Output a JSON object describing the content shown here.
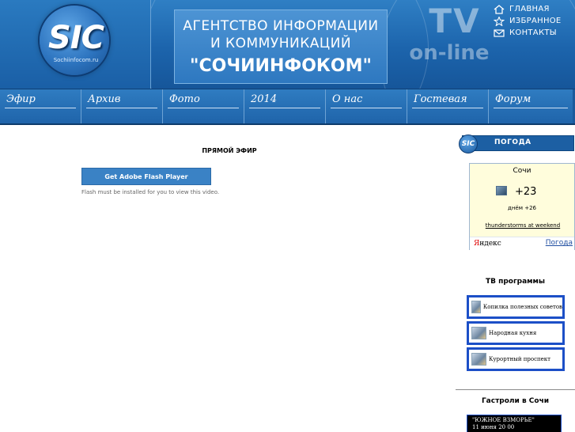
{
  "header": {
    "logo_text": "SIC",
    "logo_url": "Sochiinfocom.ru",
    "title_line1": "АГЕНТСТВО ИНФОРМАЦИИ",
    "title_line2": "И КОММУНИКАЦИЙ",
    "title_line3": "\"СОЧИИНФОКОМ\"",
    "tv_text": "TV",
    "online_text": "on-line",
    "links": [
      {
        "label": "ГЛАВНАЯ",
        "icon": "home-icon"
      },
      {
        "label": "ИЗБРАННОЕ",
        "icon": "star-icon"
      },
      {
        "label": "КОНТАКТЫ",
        "icon": "mail-icon"
      }
    ]
  },
  "nav": {
    "items": [
      {
        "label": "Эфир"
      },
      {
        "label": "Архив"
      },
      {
        "label": "Фото"
      },
      {
        "label": "2014"
      },
      {
        "label": "О нас"
      },
      {
        "label": "Гостевая"
      },
      {
        "label": "Форум"
      }
    ]
  },
  "main": {
    "live_title": "ПРЯМОЙ ЭФИР",
    "flash_button": "Get Adobe Flash Player",
    "flash_note": "Flash must be installed for you to view this video."
  },
  "sidebar": {
    "weather": {
      "logo_text": "SIC",
      "header": "ПОГОДА",
      "city": "Сочи",
      "temp": "+23",
      "day": "днём +26",
      "description": "thunderstorms at weekend",
      "yandex_first": "Я",
      "yandex_rest": "ндекс",
      "link": "Погода"
    },
    "tv_heading": "ТВ программы",
    "tv_programs": [
      {
        "label": "Копилка полезных советов"
      },
      {
        "label": "Народная кухня"
      },
      {
        "label": "Курортный проспект"
      }
    ],
    "tour_heading": "Гастроли в Сочи",
    "tour": {
      "name": "\"ЮЖНОЕ ВЗМОРЬЕ\"",
      "date": "11 июня 20 00"
    }
  },
  "colors": {
    "header_blue": "#1c64ac",
    "nav_blue": "#1f64aa",
    "tv_border": "#1c4fc7",
    "flash_button": "#3a82c5"
  }
}
